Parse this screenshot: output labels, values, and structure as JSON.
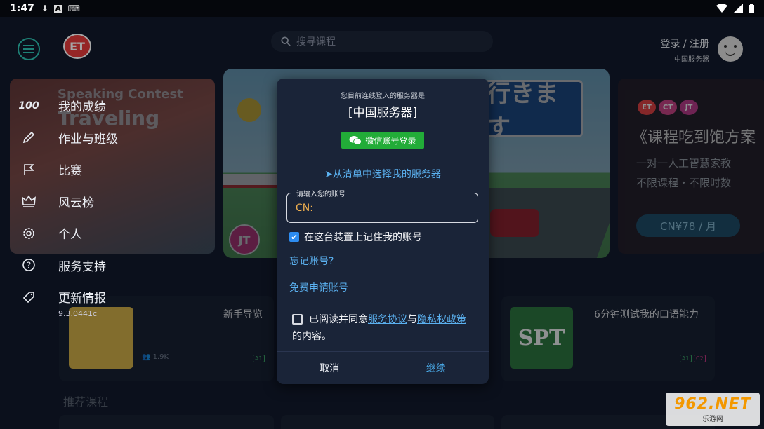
{
  "status_bar": {
    "time": "1:47",
    "icons": [
      "download-icon",
      "a-icon",
      "keyboard-icon"
    ],
    "right_icons": [
      "wifi-icon",
      "signal-icon",
      "battery-icon"
    ]
  },
  "header": {
    "logo_text": "ET",
    "search_placeholder": "搜寻课程",
    "login_label": "登录 / 注册",
    "server_label": "中国服务器"
  },
  "sidebar": {
    "items": [
      {
        "label": "我的成绩",
        "icon": "score-100-icon"
      },
      {
        "label": "作业与班级",
        "icon": "pencil-icon"
      },
      {
        "label": "比赛",
        "icon": "flag-icon"
      },
      {
        "label": "风云榜",
        "icon": "crown-icon"
      },
      {
        "label": "个人",
        "icon": "gear-icon"
      },
      {
        "label": "服务支持",
        "icon": "help-icon"
      },
      {
        "label": "更新情报",
        "icon": "tag-icon"
      }
    ],
    "version": "9.3.0441c"
  },
  "banners": {
    "left_line1": "Speaking Contest",
    "left_line2": "Traveling",
    "center_sign": "行きます",
    "center_logo": "JT",
    "right_logos": [
      "ET",
      "CT",
      "JT"
    ],
    "right_title": "《课程吃到饱方案",
    "right_sub1": "一对一人工智慧家教",
    "right_sub2": "不限课程・不限时数",
    "right_price": "CN¥78 / 月"
  },
  "cards": {
    "card1_title": "新手导览",
    "card1_meta": "1.9K",
    "card1_tag": "A1",
    "card3_title": "6分钟测试我的口语能力",
    "card3_thumb": "SPT",
    "card3_tags": [
      "A1",
      "C2"
    ],
    "section_title": "推荐课程"
  },
  "dialog": {
    "hint": "您目前连线登入的服务器是",
    "server": "[中国服务器]",
    "wechat_button": "微信账号登录",
    "choose_server": "➤从清单中选择我的服务器",
    "account_label": "请输入您的账号",
    "account_value": "CN:",
    "remember_label": "在这台装置上记住我的账号",
    "remember_checked": true,
    "forgot_link": "忘记账号?",
    "apply_link": "免费申请账号",
    "agree_prefix": "已阅读并同意",
    "agree_service": "服务协议",
    "agree_and": "与",
    "agree_privacy": "隐私权政策",
    "agree_suffix": "的内容。",
    "agree_checked": false,
    "cancel_button": "取消",
    "continue_button": "继续"
  },
  "watermark": {
    "line1": "962.NET",
    "line2": "乐游网"
  },
  "colors": {
    "accent_teal": "#2ec5b6",
    "link_blue": "#5bb1f0",
    "wechat_green": "#22ac38",
    "value_orange": "#f0b050"
  }
}
